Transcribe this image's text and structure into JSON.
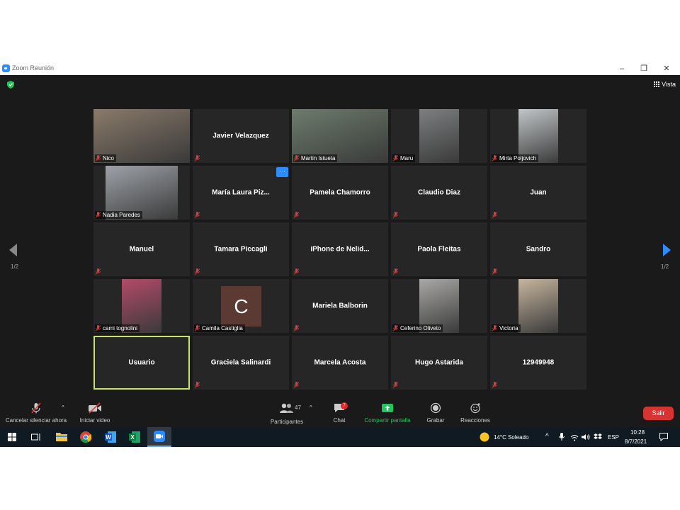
{
  "window": {
    "title": "Zoom Reunión"
  },
  "header": {
    "view_label": "Vista"
  },
  "pager": {
    "left": "1/2",
    "right": "1/2"
  },
  "tiles": [
    {
      "name": "Nico",
      "video": true
    },
    {
      "name": "Javier Velazquez",
      "video": false
    },
    {
      "name": "Martin Istueta",
      "video": true
    },
    {
      "name": "Maru",
      "video": true
    },
    {
      "name": "Mirta Poljovich",
      "video": true
    },
    {
      "name": "Nadia Paredes",
      "video": true
    },
    {
      "name": "María Laura Piz...",
      "video": false,
      "more_label": "···"
    },
    {
      "name": "Pamela Chamorro",
      "video": false
    },
    {
      "name": "Claudio Diaz",
      "video": false
    },
    {
      "name": "Juan",
      "video": false
    },
    {
      "name": "Manuel",
      "video": false
    },
    {
      "name": "Tamara Piccagli",
      "video": false
    },
    {
      "name": "iPhone de Nelid...",
      "video": false
    },
    {
      "name": "Paola Fleitas",
      "video": false
    },
    {
      "name": "Sandro",
      "video": false
    },
    {
      "name": "cami tognolini",
      "video": true
    },
    {
      "name": "Camila Castiglia",
      "video": false,
      "avatar_letter": "C"
    },
    {
      "name": "Mariela Balborin",
      "video": false
    },
    {
      "name": "Ceferino Oliveto",
      "video": true
    },
    {
      "name": "Victoria",
      "video": true
    },
    {
      "name": "Usuario",
      "video": false,
      "active_speaker": true
    },
    {
      "name": "Graciela Salinardi",
      "video": false
    },
    {
      "name": "Marcela Acosta",
      "video": false
    },
    {
      "name": "Hugo Astarida",
      "video": false
    },
    {
      "name": "12949948",
      "video": false
    }
  ],
  "toolbar": {
    "unmute": "Cancelar silenciar ahora",
    "video": "Iniciar video",
    "participants": "Participantes",
    "participants_count": "47",
    "chat": "Chat",
    "chat_badge": "7",
    "share": "Compartir pantalla",
    "record": "Grabar",
    "reactions": "Reacciones",
    "leave": "Salir"
  },
  "taskbar": {
    "weather": "14°C  Soleado",
    "lang": "ESP",
    "time": "10:28",
    "date": "8/7/2021"
  },
  "colors": {
    "zoom_blue": "#2d8cff",
    "share_green": "#22c55e",
    "leave_red": "#d83333",
    "active_speaker": "#c7e36c",
    "muted_mic": "#e03c3c"
  }
}
